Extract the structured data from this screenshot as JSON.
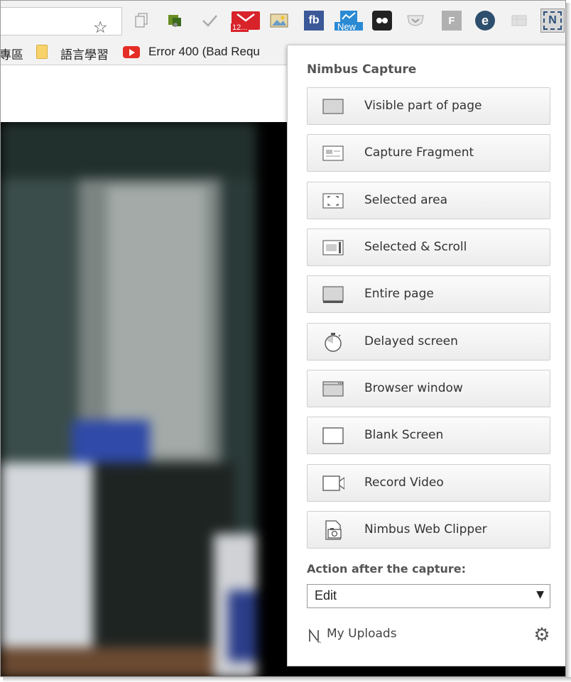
{
  "toolbar": {
    "star_glyph": "☆",
    "extensions": [
      {
        "name": "copy-extension-icon"
      },
      {
        "name": "green-extension-icon"
      },
      {
        "name": "check-extension-icon"
      },
      {
        "name": "gmail-extension-icon",
        "badge": "12..."
      },
      {
        "name": "photo-extension-icon"
      },
      {
        "name": "facebook-extension-icon",
        "text": "fb"
      },
      {
        "name": "new-extension-icon",
        "badge": "New"
      },
      {
        "name": "dots-extension-icon"
      },
      {
        "name": "pocket-extension-icon"
      },
      {
        "name": "f-extension-icon",
        "text": "F"
      },
      {
        "name": "e-extension-icon",
        "text": "e"
      },
      {
        "name": "grid-extension-icon"
      },
      {
        "name": "nimbus-extension-icon",
        "text": "N"
      }
    ]
  },
  "bookmarks": {
    "item1": "專區",
    "item2": "語言學習",
    "item3": "Error 400 (Bad Requ"
  },
  "popup": {
    "title": "Nimbus Capture",
    "items": [
      {
        "label": "Visible part of page",
        "icon": "visible-page-icon"
      },
      {
        "label": "Capture Fragment",
        "icon": "fragment-icon"
      },
      {
        "label": "Selected area",
        "icon": "selected-area-icon"
      },
      {
        "label": "Selected & Scroll",
        "icon": "selected-scroll-icon"
      },
      {
        "label": "Entire page",
        "icon": "entire-page-icon"
      },
      {
        "label": "Delayed screen",
        "icon": "timer-icon"
      },
      {
        "label": "Browser window",
        "icon": "browser-window-icon"
      },
      {
        "label": "Blank Screen",
        "icon": "blank-screen-icon"
      },
      {
        "label": "Record Video",
        "icon": "video-camera-icon"
      },
      {
        "label": "Nimbus Web Clipper",
        "icon": "web-clipper-icon"
      }
    ],
    "action_label": "Action after the capture:",
    "action_value": "Edit",
    "action_arrow": "▼",
    "uploads_label": "My Uploads",
    "gear_glyph": "⚙"
  },
  "colors": {
    "accent_red": "#d8232a",
    "facebook_blue": "#3b5998",
    "new_blue": "#2a8ad4"
  }
}
